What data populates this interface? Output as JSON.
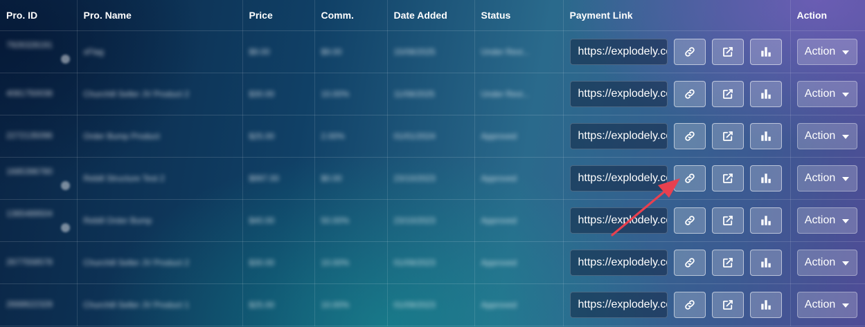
{
  "columns": {
    "pro_id": "Pro. ID",
    "pro_name": "Pro. Name",
    "price": "Price",
    "comm": "Comm.",
    "date_added": "Date Added",
    "status": "Status",
    "payment_link": "Payment Link",
    "action": "Action"
  },
  "rows": [
    {
      "pro_id": "7926328191",
      "pro_name": "xFlag",
      "price": "$9.00",
      "comm": "$9.00",
      "date": "15/08/2025",
      "status": "Under Revi...",
      "link": "https://explodely.com/",
      "action": "Action"
    },
    {
      "pro_id": "4081750038",
      "pro_name": "Churchill Seller JV Product 2",
      "price": "$30.00",
      "comm": "10.00%",
      "date": "11/08/2025",
      "status": "Under Revi...",
      "link": "https://explodely.com/",
      "action": "Action"
    },
    {
      "pro_id": "2272135096",
      "pro_name": "Order Bump Product",
      "price": "$25.00",
      "comm": "2.00%",
      "date": "01/01/2024",
      "status": "Approved",
      "link": "https://explodely.com/",
      "action": "Action"
    },
    {
      "pro_id": "1685396780",
      "pro_name": "Rebill Structure Test 2",
      "price": "$997.00",
      "comm": "$0.00",
      "date": "23/10/2023",
      "status": "Approved",
      "link": "https://explodely.com/",
      "action": "Action"
    },
    {
      "pro_id": "1365489504",
      "pro_name": "Rebill Order Bump",
      "price": "$40.00",
      "comm": "50.00%",
      "date": "23/10/2023",
      "status": "Approved",
      "link": "https://explodely.com/",
      "action": "Action"
    },
    {
      "pro_id": "2677558578",
      "pro_name": "Churchill Seller JV Product 2",
      "price": "$30.00",
      "comm": "10.00%",
      "date": "01/09/2023",
      "status": "Approved",
      "link": "https://explodely.com/",
      "action": "Action"
    },
    {
      "pro_id": "2668622328",
      "pro_name": "Churchill Seller JV Product 1",
      "price": "$25.00",
      "comm": "10.00%",
      "date": "01/09/2023",
      "status": "Approved",
      "link": "https://explodely.com/",
      "action": "Action"
    }
  ],
  "icons": {
    "copy": "link-icon",
    "open": "external-link-icon",
    "stats": "bar-chart-icon",
    "caret": "caret-down-icon"
  },
  "colors": {
    "annotation_arrow": "#e8404f"
  }
}
